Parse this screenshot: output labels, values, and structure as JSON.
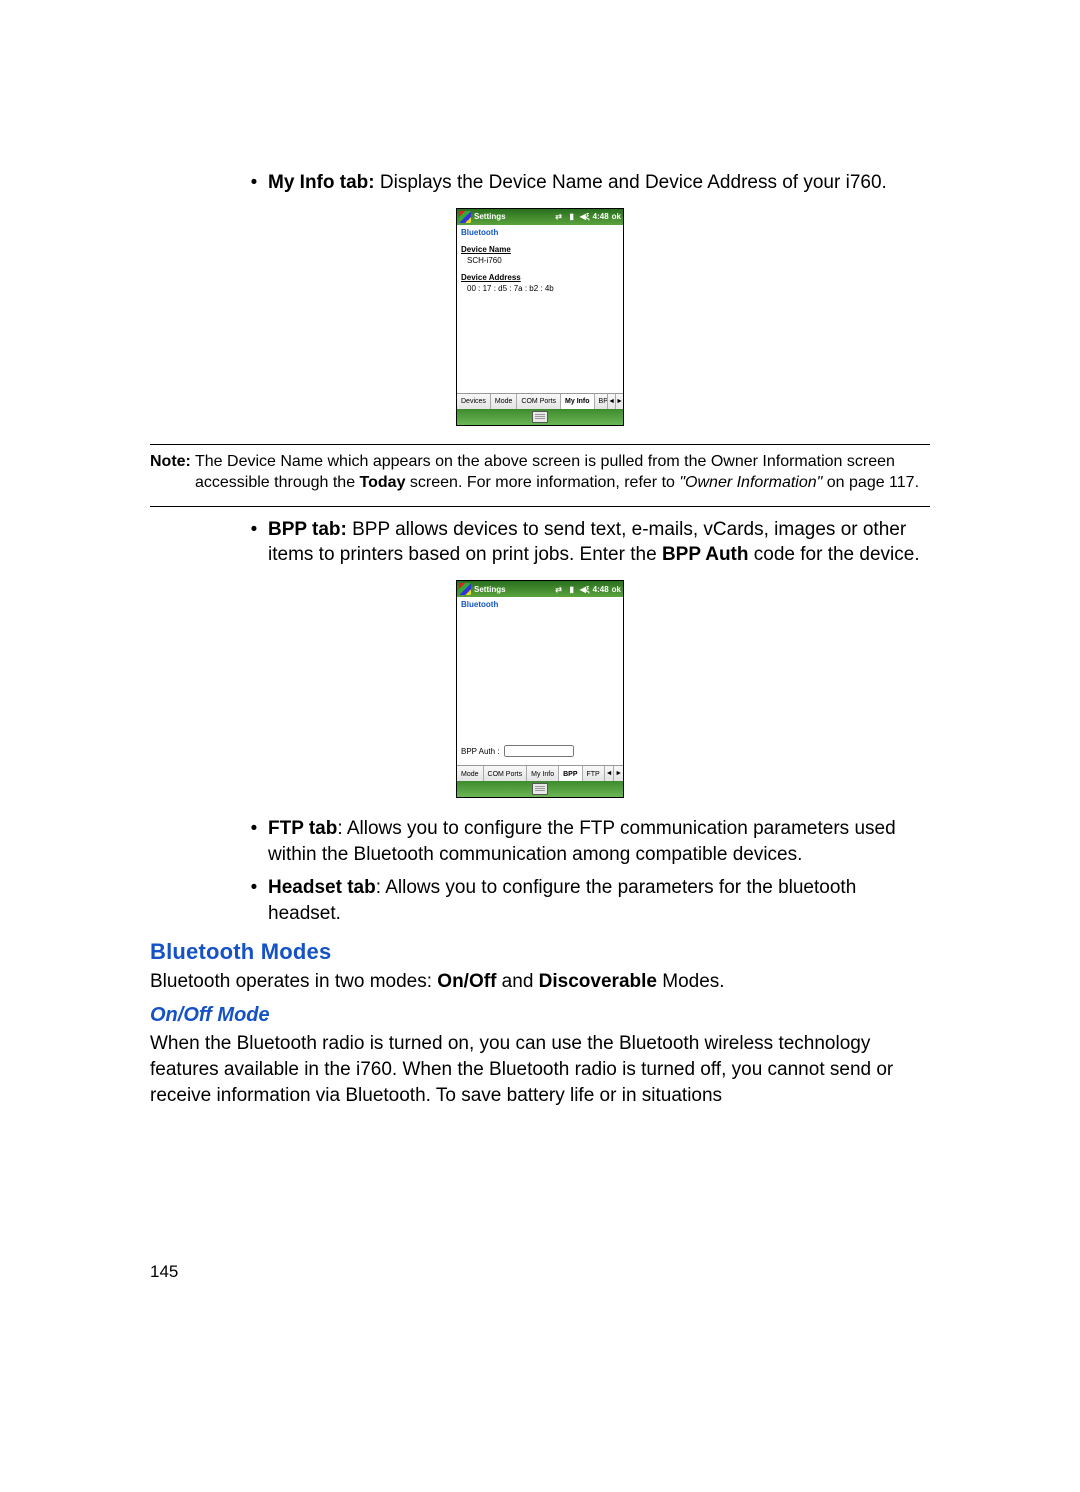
{
  "bullets": {
    "myinfo": {
      "label": "My Info tab:",
      "text": " Displays the Device Name and Device Address of your i760."
    },
    "bpp": {
      "label": "BPP tab:",
      "line1": " BPP allows devices to send text, e-mails, vCards, images or other items to printers based on print jobs. Enter the ",
      "bold_inline": "BPP Auth",
      "line2": " code for the device."
    },
    "ftp": {
      "label": "FTP tab",
      "text": ": Allows you to configure the FTP communication parameters used within the Bluetooth communication among compatible devices."
    },
    "headset": {
      "label": "Headset tab",
      "text": ": Allows you to configure the parameters for the bluetooth headset."
    }
  },
  "note": {
    "label": "Note:",
    "pre": " The Device Name which appears on the above screen is pulled from the Owner Information screen accessible through the ",
    "bold1": "Today",
    "mid": " screen. For more information, refer to ",
    "italic": "\"Owner Information\"",
    "post": "  on page 117."
  },
  "headings": {
    "modes": "Bluetooth Modes",
    "onoff": "On/Off Mode"
  },
  "paragraphs": {
    "modes": {
      "pre": "Bluetooth operates in two modes: ",
      "b1": "On/Off",
      "mid": " and ",
      "b2": "Discoverable",
      "post": " Modes."
    },
    "onoff": "When the Bluetooth radio is turned on, you can use the Bluetooth wireless technology features available in the i760. When the Bluetooth radio is turned off, you cannot send or receive information via Bluetooth. To save battery life or in situations"
  },
  "page_number": "145",
  "wm_common": {
    "title": "Settings",
    "subtitle": "Bluetooth",
    "time": "4:48",
    "ok": "ok",
    "arrows": {
      "left": "◄",
      "right": "►"
    }
  },
  "wm1": {
    "labels": {
      "device_name": "Device Name",
      "device_address": "Device Address"
    },
    "values": {
      "device_name": "SCH-i760",
      "device_address": "00 : 17 : d5 : 7a : b2 : 4b"
    },
    "tabs": [
      "Devices",
      "Mode",
      "COM Ports",
      "My Info",
      "BPP"
    ],
    "active_tab_index": 3
  },
  "wm2": {
    "bpp_label": "BPP Auth :",
    "bpp_value": "",
    "tabs": [
      "Mode",
      "COM Ports",
      "My Info",
      "BPP",
      "FTP"
    ],
    "active_tab_index": 3
  }
}
